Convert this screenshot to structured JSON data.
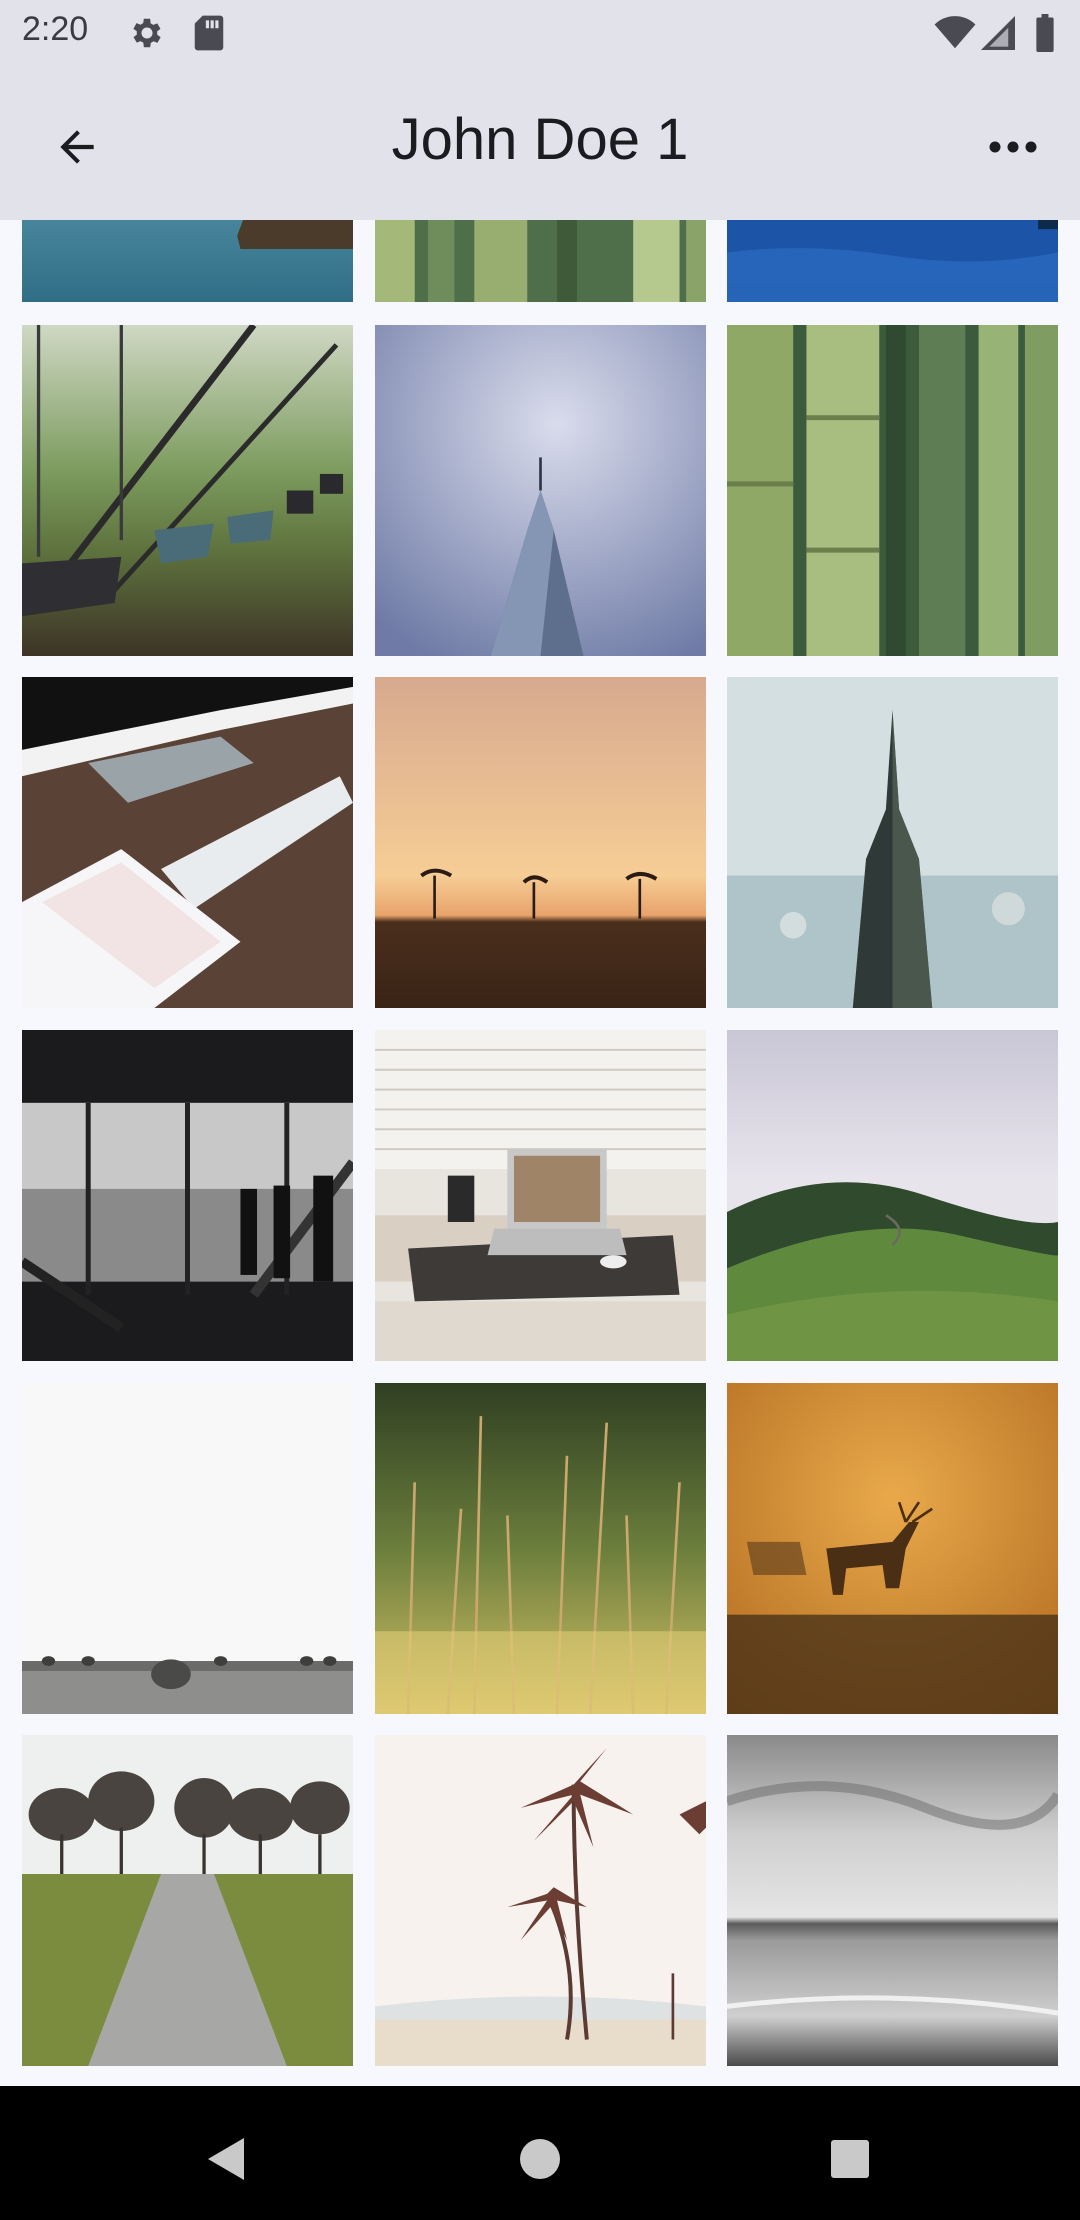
{
  "status_bar": {
    "time": "2:20",
    "icons": [
      "gear-icon",
      "sd-card-icon",
      "wifi-icon",
      "signal-icon",
      "battery-icon"
    ]
  },
  "app_bar": {
    "title": "John Doe 1",
    "back_icon": "arrow-back-icon",
    "more_icon": "more-horiz-icon"
  },
  "photos": [
    "lake-rock",
    "bamboo-stalks",
    "ocean-water",
    "playground-swings",
    "skyscraper-tower",
    "bamboo-closeup",
    "desk-keyboard-tablet",
    "sunset-palms",
    "city-tower-reflection",
    "office-window-silhouettes",
    "laptop-desk",
    "green-hills",
    "hay-bales-field",
    "wild-grass",
    "deer-fog",
    "tree-path",
    "palm-trees-beach",
    "bw-seashore"
  ],
  "nav_bar": {
    "icons": [
      "back-triangle-icon",
      "home-circle-icon",
      "recents-square-icon"
    ]
  },
  "colors": {
    "app_bar_bg": "#e2e3ea",
    "page_bg": "#f7f8fd",
    "nav_bar_bg": "#000000"
  }
}
